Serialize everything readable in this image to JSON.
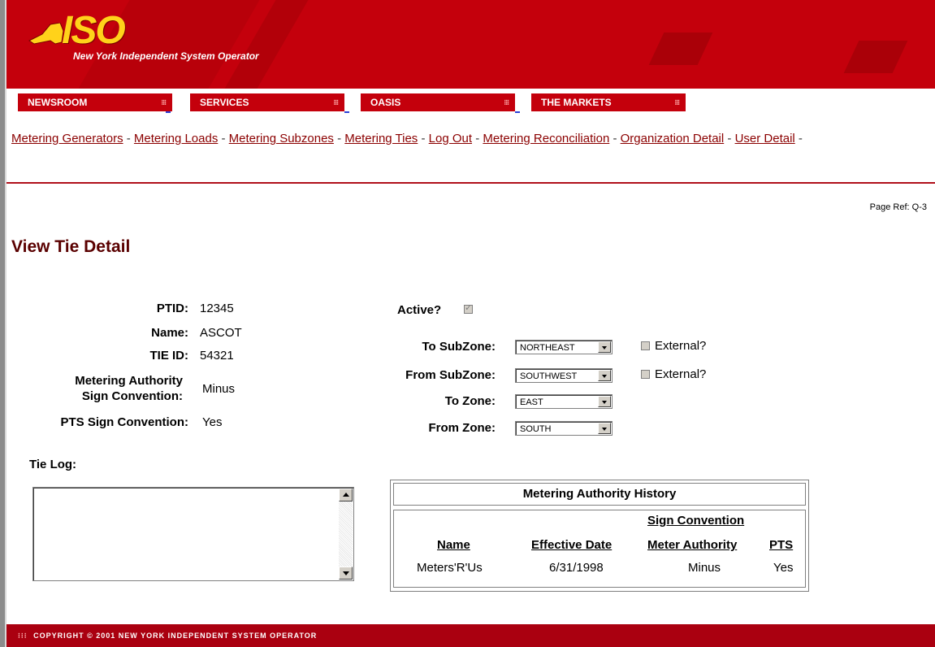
{
  "brand": {
    "logo_text": "ISO",
    "subtitle": "New York Independent System Operator",
    "primary_color": "#c4000c",
    "logo_color": "#ffd21a"
  },
  "nav": {
    "tabs": [
      {
        "label": "NEWSROOM"
      },
      {
        "label": "SERVICES"
      },
      {
        "label": "OASIS"
      },
      {
        "label": "THE MARKETS"
      }
    ],
    "dots": "⁝⁝⁝"
  },
  "links": [
    {
      "label": "Metering Generators"
    },
    {
      "label": "Metering Loads"
    },
    {
      "label": "Metering Subzones"
    },
    {
      "label": "Metering Ties"
    },
    {
      "label": "Log Out"
    },
    {
      "label": "Metering Reconciliation"
    },
    {
      "label": "Organization Detail"
    },
    {
      "label": "User Detail"
    }
  ],
  "separator": "-",
  "page_ref": "Page Ref: Q-3",
  "title": "View Tie Detail",
  "fields": {
    "ptid": {
      "label": "PTID:",
      "value": "12345"
    },
    "name": {
      "label": "Name:",
      "value": "ASCOT"
    },
    "tie_id": {
      "label": "TIE ID:",
      "value": "54321"
    },
    "ma_sign": {
      "label_line1": "Metering Authority",
      "label_line2": "Sign Convention:",
      "value": "Minus"
    },
    "pts_sign": {
      "label": "PTS Sign Convention:",
      "value": "Yes"
    }
  },
  "active": {
    "label": "Active?",
    "checked": true
  },
  "zones": {
    "to_subzone": {
      "label": "To SubZone:",
      "value": "NORTHEAST",
      "external_label": "External?"
    },
    "from_subzone": {
      "label": "From SubZone:",
      "value": "SOUTHWEST",
      "external_label": "External?"
    },
    "to_zone": {
      "label": "To Zone:",
      "value": "EAST"
    },
    "from_zone": {
      "label": "From Zone:",
      "value": "SOUTH"
    }
  },
  "tie_log": {
    "label": "Tie Log:",
    "value": ""
  },
  "history": {
    "title": "Metering Authority History",
    "group_header": "Sign Convention",
    "columns": [
      "Name",
      "Effective Date",
      "Meter Authority",
      "PTS"
    ],
    "rows": [
      {
        "name": "Meters'R'Us",
        "effective_date": "6/31/1998",
        "meter_authority": "Minus",
        "pts": "Yes"
      }
    ]
  },
  "footer": {
    "text": "COPYRIGHT © 2001 NEW YORK INDEPENDENT SYSTEM OPERATOR"
  }
}
